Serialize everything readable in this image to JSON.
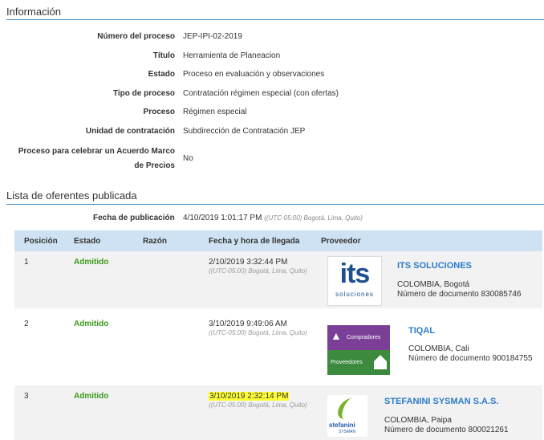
{
  "sections": {
    "informacion": "Información",
    "lista": "Lista de oferentes publicada"
  },
  "info": [
    {
      "label": "Número del proceso",
      "value": "JEP-IPI-02-2019"
    },
    {
      "label": "Título",
      "value": "Herramienta de Planeacion"
    },
    {
      "label": "Estado",
      "value": "Proceso en evaluación y observaciones"
    },
    {
      "label": "Tipo de proceso",
      "value": "Contratación régimen especial (con ofertas)"
    },
    {
      "label": "Proceso",
      "value": "Régimen especial"
    },
    {
      "label": "Unidad de contratación",
      "value": "Subdirección de Contratación JEP"
    }
  ],
  "acuerdo": {
    "label_line1": "Proceso para celebrar un Acuerdo Marco",
    "label_line2": "de Precios",
    "value": "No"
  },
  "publicacion": {
    "label": "Fecha de publicación",
    "value": "4/10/2019 1:01:17 PM",
    "tz": "((UTC-05:00) Bogotá, Lima, Quito)"
  },
  "table": {
    "headers": [
      "Posición",
      "Estado",
      "Razón",
      "Fecha y hora de llegada",
      "Proveedor"
    ],
    "rows": [
      {
        "pos": "1",
        "estado": "Admitido",
        "fecha": "2/10/2019 3:32:44 PM",
        "tz": "((UTC-05:00) Bogotá, Lima, Quito)",
        "nombre": "ITS SOLUCIONES",
        "ubicacion": "COLOMBIA, Bogotá",
        "documento": "Número de documento 830085746",
        "logo": {
          "text": "its",
          "subtext": "soluciones"
        }
      },
      {
        "pos": "2",
        "estado": "Admitido",
        "fecha": "3/10/2019 9:49:06 AM",
        "tz": "((UTC-05:00) Bogotá, Lima, Quito)",
        "nombre": "TIQAL",
        "ubicacion": "COLOMBIA, Cali",
        "documento": "Número de documento 900184755",
        "logo": {
          "top": "Compradores",
          "bottom": "Proveedores"
        }
      },
      {
        "pos": "3",
        "estado": "Admitido",
        "fecha": "3/10/2019 2:32:14 PM",
        "tz": "((UTC-05:00) Bogotá, Lima, Quito)",
        "nombre": "STEFANINI SYSMAN S.A.S.",
        "ubicacion": "COLOMBIA, Paipa",
        "documento": "Número de documento 800021261",
        "logo": {
          "text": "stefanini",
          "subtext": "SYSMAN"
        }
      }
    ]
  },
  "colors": {
    "accent_line": "#4a90c8",
    "header_bg": "#cfe2f3",
    "status_green": "#3a9a1a",
    "provider_blue": "#2a7bc8",
    "highlight": "#ffff33"
  }
}
